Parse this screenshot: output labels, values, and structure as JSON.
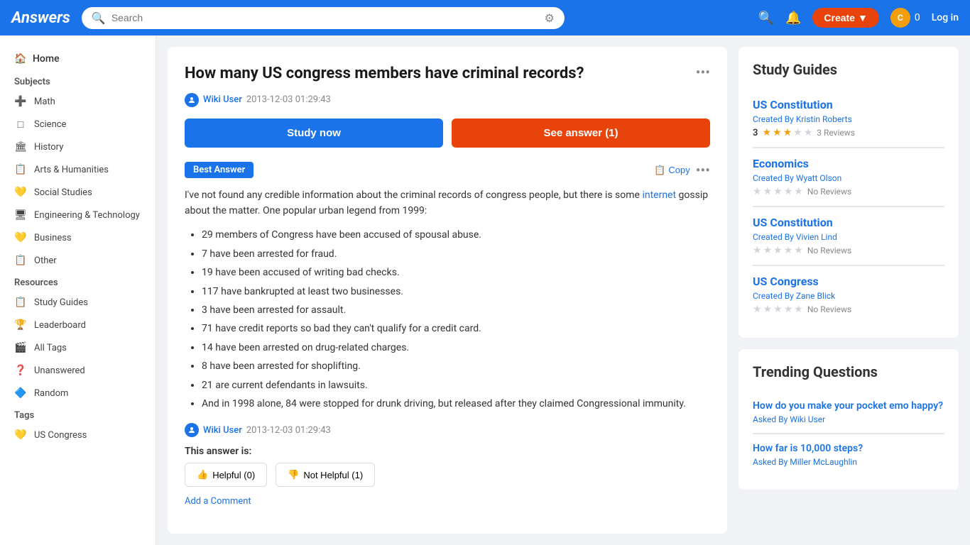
{
  "header": {
    "logo": "Answers",
    "search_placeholder": "Search",
    "create_label": "Create",
    "user_count": "0",
    "login_label": "Log in"
  },
  "sidebar": {
    "home_label": "Home",
    "subjects_title": "Subjects",
    "subjects": [
      {
        "id": "math",
        "label": "Math",
        "icon": "➕"
      },
      {
        "id": "science",
        "label": "Science",
        "icon": "□"
      },
      {
        "id": "history",
        "label": "History",
        "icon": "🏛"
      },
      {
        "id": "arts",
        "label": "Arts & Humanities",
        "icon": "📋"
      },
      {
        "id": "social",
        "label": "Social Studies",
        "icon": "💛"
      },
      {
        "id": "engineering",
        "label": "Engineering & Technology",
        "icon": "🖥"
      },
      {
        "id": "business",
        "label": "Business",
        "icon": "💛"
      },
      {
        "id": "other",
        "label": "Other",
        "icon": "📋"
      }
    ],
    "resources_title": "Resources",
    "resources": [
      {
        "id": "study-guides",
        "label": "Study Guides",
        "icon": "📋"
      },
      {
        "id": "leaderboard",
        "label": "Leaderboard",
        "icon": "🏆"
      },
      {
        "id": "all-tags",
        "label": "All Tags",
        "icon": "🎬"
      },
      {
        "id": "unanswered",
        "label": "Unanswered",
        "icon": "❓"
      },
      {
        "id": "random",
        "label": "Random",
        "icon": "🔷"
      }
    ],
    "tags_title": "Tags",
    "tags": [
      {
        "id": "us-congress",
        "label": "US Congress",
        "icon": "💛"
      }
    ]
  },
  "question": {
    "title": "How many US congress members have criminal records?",
    "user": "Wiki User",
    "date": "2013-12-03 01:29:43",
    "study_now_label": "Study now",
    "see_answer_label": "See answer (1)"
  },
  "answer": {
    "best_answer_label": "Best Answer",
    "copy_label": "Copy",
    "intro": "I've not found any credible information about the criminal records of congress people, but there is some ",
    "internet_link": "internet",
    "outro": " gossip about the matter. One popular urban legend from 1999:",
    "list_items": [
      "29 members of Congress have been accused of spousal abuse.",
      "7 have been arrested for fraud.",
      "19 have been accused of writing bad checks.",
      "117 have bankrupted at least two businesses.",
      "3 have been arrested for assault.",
      "71 have credit reports so bad they can't qualify for a credit card.",
      "14 have been arrested on drug-related charges.",
      "8 have been arrested for shoplifting.",
      "21 are current defendants in lawsuits.",
      "And in 1998 alone, 84 were stopped for drunk driving, but released after they claimed Congressional immunity."
    ],
    "user": "Wiki User",
    "date": "2013-12-03 01:29:43",
    "rating_label": "This answer is:",
    "helpful_label": "Helpful (0)",
    "not_helpful_label": "Not Helpful (1)",
    "add_comment_label": "Add a Comment"
  },
  "study_guides": {
    "title": "Study Guides",
    "items": [
      {
        "name": "US Constitution",
        "created_by": "Created By",
        "creator": "Kristin Roberts",
        "rating": 3.0,
        "filled_stars": 3,
        "empty_stars": 2,
        "reviews": "3 Reviews"
      },
      {
        "name": "Economics",
        "created_by": "Created By",
        "creator": "Wyatt Olson",
        "rating": 0,
        "filled_stars": 0,
        "empty_stars": 5,
        "reviews": "No Reviews"
      },
      {
        "name": "US Constitution",
        "created_by": "Created By",
        "creator": "Vivien Lind",
        "rating": 0,
        "filled_stars": 0,
        "empty_stars": 5,
        "reviews": "No Reviews"
      },
      {
        "name": "US Congress",
        "created_by": "Created By",
        "creator": "Zane Blick",
        "rating": 0,
        "filled_stars": 0,
        "empty_stars": 5,
        "reviews": "No Reviews"
      }
    ]
  },
  "trending": {
    "title": "Trending Questions",
    "items": [
      {
        "question": "How do you make your pocket emo happy?",
        "asked_by": "Asked By",
        "asker": "Wiki User"
      },
      {
        "question": "How far is 10,000 steps?",
        "asked_by": "Asked By",
        "asker": "Miller McLaughlin"
      }
    ]
  }
}
